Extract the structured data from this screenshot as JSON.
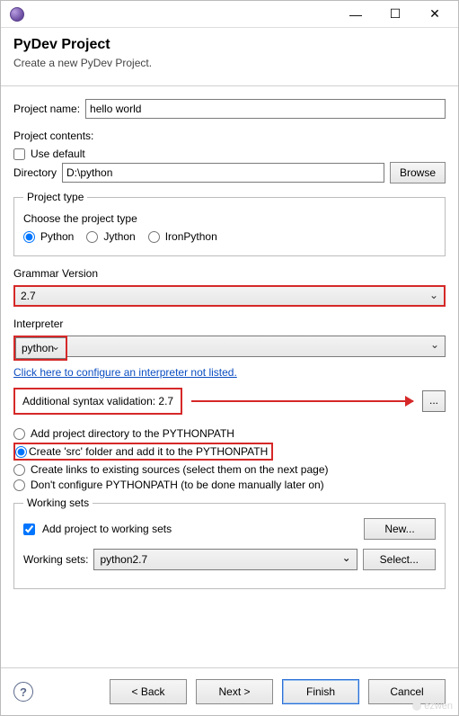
{
  "titlebar": {
    "minimize": "—",
    "maximize": "☐",
    "close": "✕"
  },
  "banner": {
    "title": "PyDev Project",
    "subtitle": "Create a new PyDev Project."
  },
  "project_name": {
    "label": "Project name:",
    "value": "hello world"
  },
  "project_contents": {
    "heading": "Project contents:",
    "use_default_label": "Use default",
    "directory_label": "Directory",
    "directory_value": "D:\\python",
    "browse_label": "Browse"
  },
  "project_type": {
    "legend": "Project type",
    "choose_label": "Choose the project type",
    "options": {
      "python": "Python",
      "jython": "Jython",
      "ironpython": "IronPython"
    }
  },
  "grammar": {
    "label": "Grammar Version",
    "value": "2.7"
  },
  "interpreter": {
    "label": "Interpreter",
    "value": "python",
    "configure_link": "Click here to configure an interpreter not listed."
  },
  "syntax": {
    "label": "Additional syntax validation: 2.7",
    "dots": "..."
  },
  "pythonpath_options": {
    "add_dir": "Add project directory to the PYTHONPATH",
    "create_src": "Create 'src' folder and add it to the PYTHONPATH",
    "create_links": "Create links to existing sources (select them on the next page)",
    "dont_configure": "Don't configure PYTHONPATH (to be done manually later on)"
  },
  "working_sets": {
    "legend": "Working sets",
    "add_label": "Add project to working sets",
    "new_label": "New...",
    "ws_label": "Working sets:",
    "ws_value": "python2.7",
    "select_label": "Select..."
  },
  "footer": {
    "back": "< Back",
    "next": "Next >",
    "finish": "Finish",
    "cancel": "Cancel"
  },
  "watermark": "ezwen"
}
